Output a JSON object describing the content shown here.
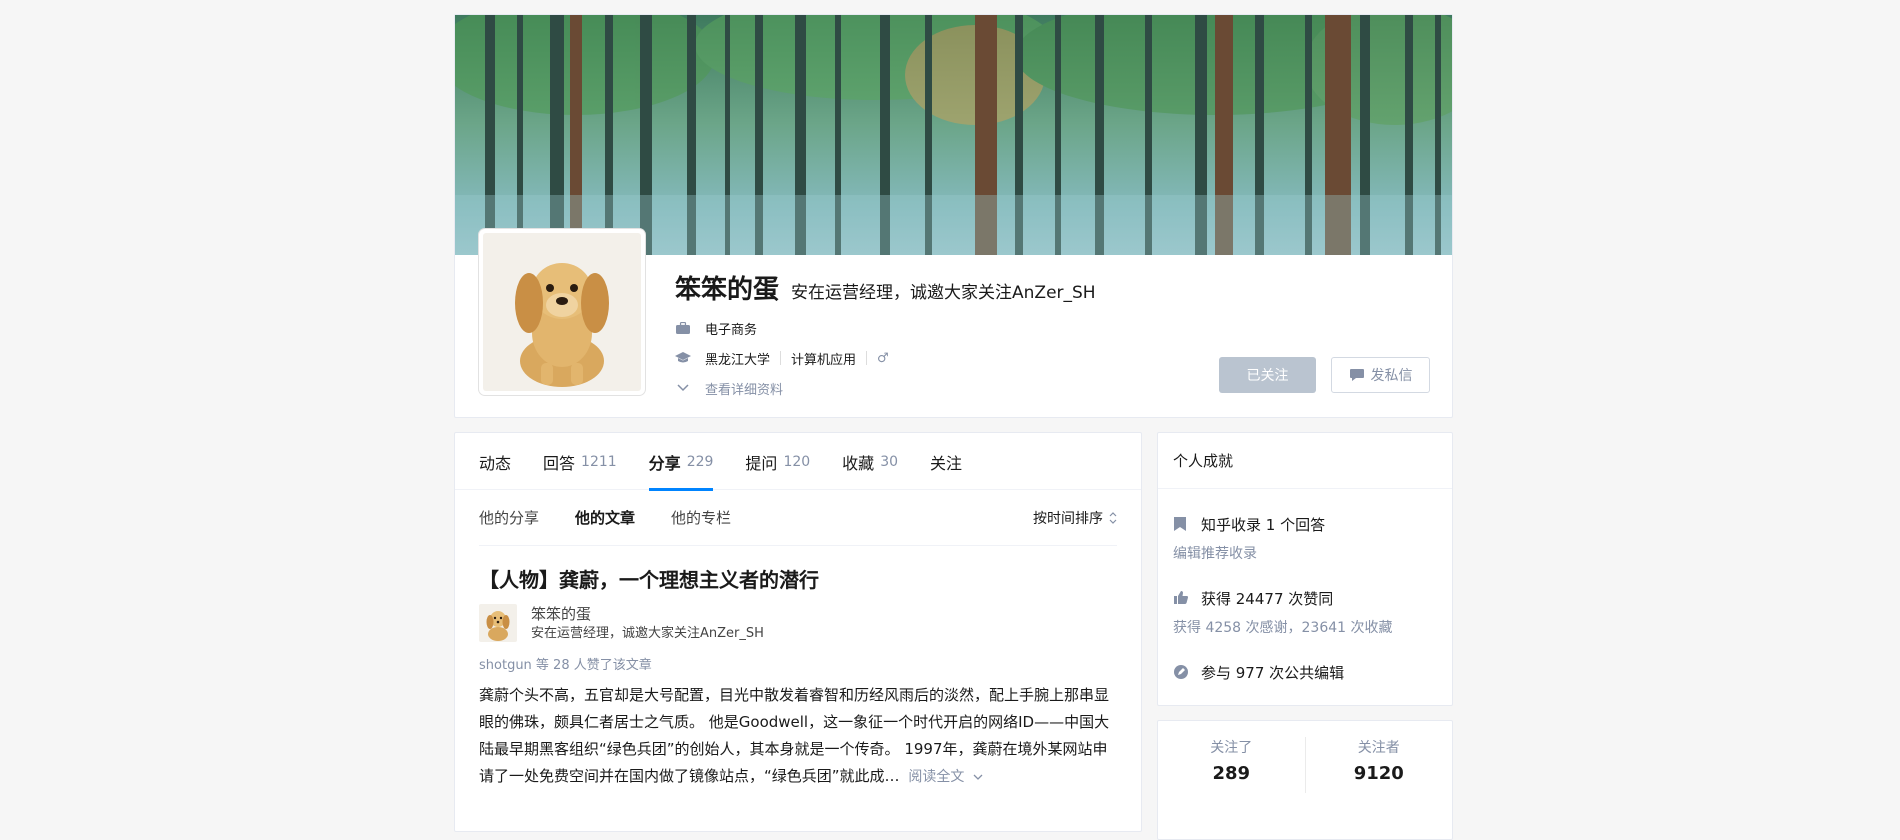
{
  "profile": {
    "name": "笨笨的蛋",
    "headline": "安在运营经理，诚邀大家关注AnZer_SH",
    "industry": "电子商务",
    "school": "黑龙江大学",
    "major": "计算机应用",
    "gender_symbol": "♂",
    "more_info": "查看详细资料",
    "follow_button": "已关注",
    "message_button": "发私信"
  },
  "tabs": [
    {
      "label": "动态",
      "count": ""
    },
    {
      "label": "回答",
      "count": "1211"
    },
    {
      "label": "分享",
      "count": "229"
    },
    {
      "label": "提问",
      "count": "120"
    },
    {
      "label": "收藏",
      "count": "30"
    },
    {
      "label": "关注",
      "count": ""
    }
  ],
  "subtabs": [
    "他的分享",
    "他的文章",
    "他的专栏"
  ],
  "sort_label": "按时间排序",
  "article": {
    "title": "【人物】龚蔚，一个理想主义者的潜行",
    "author_name": "笨笨的蛋",
    "author_bio": "安在运营经理，诚邀大家关注AnZer_SH",
    "voters": "shotgun 等 28 人赞了该文章",
    "excerpt": "龚蔚个头不高，五官却是大号配置，目光中散发着睿智和历经风雨后的淡然，配上手腕上那串显眼的佛珠，颇具仁者居士之气质。 他是Goodwell，这一象征一个时代开启的网络ID——中国大陆最早期黑客组织“绿色兵团”的创始人，其本身就是一个传奇。 1997年，龚蔚在境外某网站申请了一处免费空间并在国内做了镜像站点，“绿色兵团”就此成…",
    "read_more": "阅读全文"
  },
  "achievements": {
    "title": "个人成就",
    "collected": "知乎收录 1 个回答",
    "collected_link": "编辑推荐收录",
    "votes": "获得 24477 次赞同",
    "thanks": "获得 4258 次感谢，23641 次收藏",
    "edits": "参与 977 次公共编辑"
  },
  "follow": {
    "following_label": "关注了",
    "following_count": "289",
    "followers_label": "关注者",
    "followers_count": "9120"
  },
  "colors": {
    "accent": "#0084ff",
    "muted": "#8590a6",
    "followed_button": "#bac4d0"
  }
}
